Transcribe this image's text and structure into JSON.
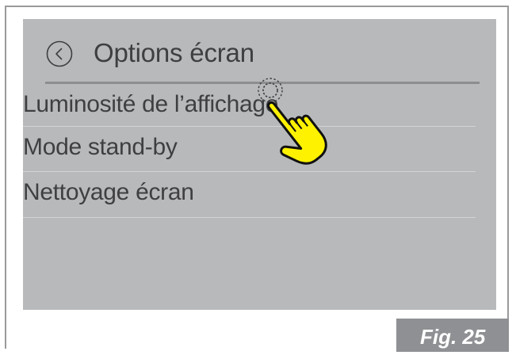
{
  "header": {
    "title": "Options écran",
    "back_icon": "chevron-left-circle-icon"
  },
  "menu": {
    "items": [
      {
        "label": "Luminosité de l’affichage"
      },
      {
        "label": "Mode stand-by"
      },
      {
        "label": "Nettoyage écran"
      }
    ]
  },
  "gesture": {
    "icon": "tap-hand-icon",
    "color": "#fff200"
  },
  "figure": {
    "label": "Fig. 25"
  },
  "colors": {
    "screen_bg": "#b7b9bb",
    "text": "#3f3f41",
    "fig_bg": "#8f9093"
  }
}
